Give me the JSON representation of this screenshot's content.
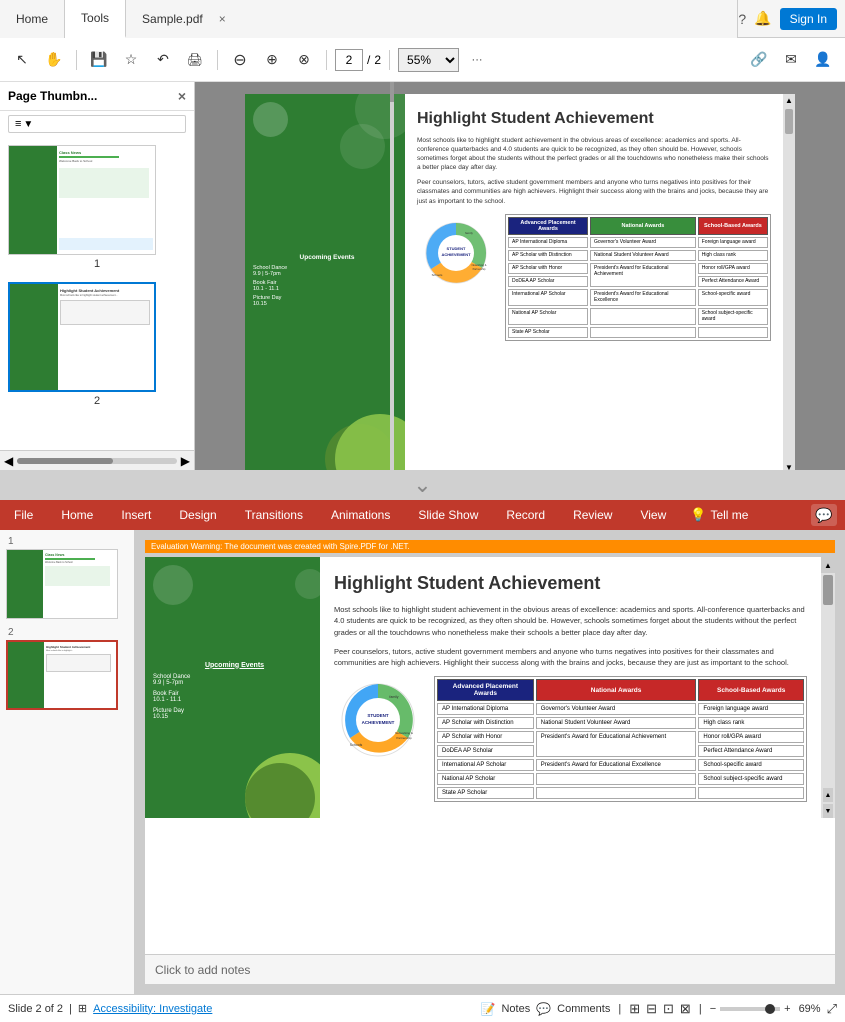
{
  "titlebar": {
    "tab_home": "Home",
    "tab_tools": "Tools",
    "tab_file": "Sample.pdf",
    "close_label": "×",
    "help_icon": "?",
    "bell_icon": "🔔",
    "sign_in": "Sign In"
  },
  "toolbar": {
    "save_icon": "💾",
    "bookmark_icon": "☆",
    "back_icon": "↶",
    "print_icon": "🖨",
    "zoom_out_icon": "⊖",
    "upload_icon": "⊕",
    "download_icon": "⊗",
    "page_current": "2",
    "page_total": "2",
    "zoom_percent": "55%",
    "more_icon": "···",
    "link_icon": "🔗",
    "mail_icon": "✉",
    "user_icon": "👤",
    "cursor_icon": "↖",
    "hand_icon": "✋"
  },
  "sidebar": {
    "title": "Page Thumbn...",
    "close_icon": "×",
    "view_icon": "≡",
    "thumb1_num": "1",
    "thumb2_num": "2"
  },
  "pdf": {
    "page2": {
      "title": "Highlight Student Achievement",
      "body1": "Most schools like to highlight student achievement in the obvious areas of excellence: academics and sports. All-conference quarterbacks and 4.0 students are quick to be recognized, as they often should be. However, schools sometimes forget about the students without the perfect grades or all the touchdowns who nonetheless make their schools a better place day after day.",
      "body2": "Peer counselors, tutors, active student government members and anyone who turns negatives into positives for their classmates and communities are high achievers. Highlight their success along with the brains and jocks, because they are just as important to the school.",
      "upcoming_title": "Upcoming Events",
      "event1_name": "School Dance",
      "event1_date": "9.9 | 5-7pm",
      "event2_name": "Book Fair",
      "event2_date": "10.1 - 11.1",
      "event3_name": "Picture Day",
      "event3_date": "10.15",
      "chart_label": "STUDENT\nACHIEVEMENT",
      "chart_labels": [
        "family",
        "Networking & Partnership",
        "Schools"
      ],
      "table": {
        "col1_header": "Advanced Placement Awards",
        "col2_header": "National Awards",
        "col3_header": "School-Based Awards",
        "col1_items": [
          "AP International Diploma",
          "AP Scholar with Distinction",
          "AP Scholar with Honor",
          "DoDEA AP Scholar",
          "International AP Scholar",
          "National AP Scholar",
          "State AP Scholar"
        ],
        "col2_items": [
          "Governor's Volunteer Award",
          "National Student Volunteer Award",
          "President's Award for Educational Achievement",
          "President's Award for Educational Excellence"
        ],
        "col3_items": [
          "Foreign language award",
          "High class rank",
          "Honor roll/GPA award",
          "Perfect Attendance Award",
          "School-specific award",
          "School subject-specific award"
        ]
      }
    }
  },
  "ppt": {
    "eval_bar": "Evaluation Warning: The document was created with Spire.PDF for .NET.",
    "menubar": {
      "file": "File",
      "home": "Home",
      "insert": "Insert",
      "design": "Design",
      "transitions": "Transitions",
      "animations": "Animations",
      "slide_show": "Slide Show",
      "record": "Record",
      "review": "Review",
      "view": "View",
      "tell_me_label": "Tell me",
      "bulb_icon": "💡"
    },
    "slide2": {
      "title": "Highlight Student Achievement",
      "body1": "Most schools like to highlight student achievement in the obvious areas of excellence: academics and sports. All-conference quarterbacks and 4.0 students are quick to be recognized, as they often should be. However, schools sometimes forget about the students without the perfect grades or all the touchdowns who nonetheless make their schools a better place day after day.",
      "body2": "Peer counselors, tutors, active student government members and anyone who turns negatives into positives for their classmates and communities are high achievers. Highlight their success along with the brains and jocks, because they are just as important to the school.",
      "upcoming_title": "Upcoming Events",
      "event1_name": "School Dance",
      "event1_date": "9.9 | 5-7pm",
      "event2_name": "Book Fair",
      "event2_date": "10.1 - 11.1",
      "event3_name": "Picture Day",
      "event3_date": "10.15",
      "chart_label": "STUDENT\nACHIEVEMENT",
      "table": {
        "col1_header": "Advanced Placement Awards",
        "col2_header": "National Awards",
        "col3_header": "School-Based Awards",
        "col1_items": [
          "AP International Diploma",
          "AP Scholar with Distinction",
          "AP Scholar with Honor",
          "DoDEA AP Scholar",
          "International AP Scholar",
          "National AP Scholar",
          "State AP Scholar"
        ],
        "col2_items": [
          "Governor's Volunteer Award",
          "National Student Volunteer Award",
          "President's Award for Educational Achievement",
          "President's Award for Educational Excellence"
        ],
        "col3_items": [
          "Foreign language award",
          "High class rank",
          "Honor roll/GPA award",
          "Perfect Attendance Award",
          "School-specific award",
          "School subject-specific award"
        ]
      }
    },
    "notes_placeholder": "Click to add notes",
    "status": {
      "slide_info": "Slide 2 of 2",
      "accessibility": "Accessibility: Investigate",
      "notes_label": "Notes",
      "comments_label": "Comments",
      "zoom_percent": "69%"
    }
  }
}
